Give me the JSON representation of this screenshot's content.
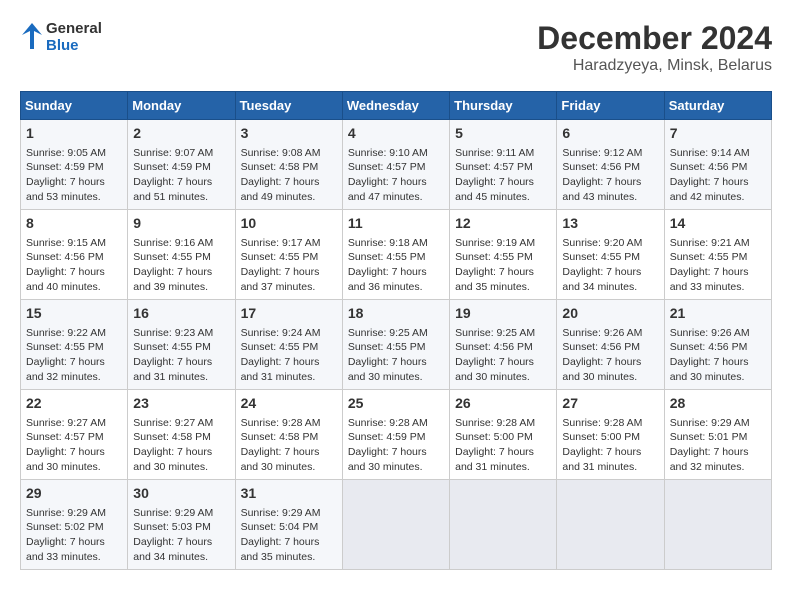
{
  "header": {
    "logo_line1": "General",
    "logo_line2": "Blue",
    "title": "December 2024",
    "subtitle": "Haradzyeya, Minsk, Belarus"
  },
  "columns": [
    "Sunday",
    "Monday",
    "Tuesday",
    "Wednesday",
    "Thursday",
    "Friday",
    "Saturday"
  ],
  "weeks": [
    [
      {
        "day": "1",
        "info": "Sunrise: 9:05 AM\nSunset: 4:59 PM\nDaylight: 7 hours\nand 53 minutes."
      },
      {
        "day": "2",
        "info": "Sunrise: 9:07 AM\nSunset: 4:59 PM\nDaylight: 7 hours\nand 51 minutes."
      },
      {
        "day": "3",
        "info": "Sunrise: 9:08 AM\nSunset: 4:58 PM\nDaylight: 7 hours\nand 49 minutes."
      },
      {
        "day": "4",
        "info": "Sunrise: 9:10 AM\nSunset: 4:57 PM\nDaylight: 7 hours\nand 47 minutes."
      },
      {
        "day": "5",
        "info": "Sunrise: 9:11 AM\nSunset: 4:57 PM\nDaylight: 7 hours\nand 45 minutes."
      },
      {
        "day": "6",
        "info": "Sunrise: 9:12 AM\nSunset: 4:56 PM\nDaylight: 7 hours\nand 43 minutes."
      },
      {
        "day": "7",
        "info": "Sunrise: 9:14 AM\nSunset: 4:56 PM\nDaylight: 7 hours\nand 42 minutes."
      }
    ],
    [
      {
        "day": "8",
        "info": "Sunrise: 9:15 AM\nSunset: 4:56 PM\nDaylight: 7 hours\nand 40 minutes."
      },
      {
        "day": "9",
        "info": "Sunrise: 9:16 AM\nSunset: 4:55 PM\nDaylight: 7 hours\nand 39 minutes."
      },
      {
        "day": "10",
        "info": "Sunrise: 9:17 AM\nSunset: 4:55 PM\nDaylight: 7 hours\nand 37 minutes."
      },
      {
        "day": "11",
        "info": "Sunrise: 9:18 AM\nSunset: 4:55 PM\nDaylight: 7 hours\nand 36 minutes."
      },
      {
        "day": "12",
        "info": "Sunrise: 9:19 AM\nSunset: 4:55 PM\nDaylight: 7 hours\nand 35 minutes."
      },
      {
        "day": "13",
        "info": "Sunrise: 9:20 AM\nSunset: 4:55 PM\nDaylight: 7 hours\nand 34 minutes."
      },
      {
        "day": "14",
        "info": "Sunrise: 9:21 AM\nSunset: 4:55 PM\nDaylight: 7 hours\nand 33 minutes."
      }
    ],
    [
      {
        "day": "15",
        "info": "Sunrise: 9:22 AM\nSunset: 4:55 PM\nDaylight: 7 hours\nand 32 minutes."
      },
      {
        "day": "16",
        "info": "Sunrise: 9:23 AM\nSunset: 4:55 PM\nDaylight: 7 hours\nand 31 minutes."
      },
      {
        "day": "17",
        "info": "Sunrise: 9:24 AM\nSunset: 4:55 PM\nDaylight: 7 hours\nand 31 minutes."
      },
      {
        "day": "18",
        "info": "Sunrise: 9:25 AM\nSunset: 4:55 PM\nDaylight: 7 hours\nand 30 minutes."
      },
      {
        "day": "19",
        "info": "Sunrise: 9:25 AM\nSunset: 4:56 PM\nDaylight: 7 hours\nand 30 minutes."
      },
      {
        "day": "20",
        "info": "Sunrise: 9:26 AM\nSunset: 4:56 PM\nDaylight: 7 hours\nand 30 minutes."
      },
      {
        "day": "21",
        "info": "Sunrise: 9:26 AM\nSunset: 4:56 PM\nDaylight: 7 hours\nand 30 minutes."
      }
    ],
    [
      {
        "day": "22",
        "info": "Sunrise: 9:27 AM\nSunset: 4:57 PM\nDaylight: 7 hours\nand 30 minutes."
      },
      {
        "day": "23",
        "info": "Sunrise: 9:27 AM\nSunset: 4:58 PM\nDaylight: 7 hours\nand 30 minutes."
      },
      {
        "day": "24",
        "info": "Sunrise: 9:28 AM\nSunset: 4:58 PM\nDaylight: 7 hours\nand 30 minutes."
      },
      {
        "day": "25",
        "info": "Sunrise: 9:28 AM\nSunset: 4:59 PM\nDaylight: 7 hours\nand 30 minutes."
      },
      {
        "day": "26",
        "info": "Sunrise: 9:28 AM\nSunset: 5:00 PM\nDaylight: 7 hours\nand 31 minutes."
      },
      {
        "day": "27",
        "info": "Sunrise: 9:28 AM\nSunset: 5:00 PM\nDaylight: 7 hours\nand 31 minutes."
      },
      {
        "day": "28",
        "info": "Sunrise: 9:29 AM\nSunset: 5:01 PM\nDaylight: 7 hours\nand 32 minutes."
      }
    ],
    [
      {
        "day": "29",
        "info": "Sunrise: 9:29 AM\nSunset: 5:02 PM\nDaylight: 7 hours\nand 33 minutes."
      },
      {
        "day": "30",
        "info": "Sunrise: 9:29 AM\nSunset: 5:03 PM\nDaylight: 7 hours\nand 34 minutes."
      },
      {
        "day": "31",
        "info": "Sunrise: 9:29 AM\nSunset: 5:04 PM\nDaylight: 7 hours\nand 35 minutes."
      },
      {
        "day": "",
        "info": ""
      },
      {
        "day": "",
        "info": ""
      },
      {
        "day": "",
        "info": ""
      },
      {
        "day": "",
        "info": ""
      }
    ]
  ]
}
